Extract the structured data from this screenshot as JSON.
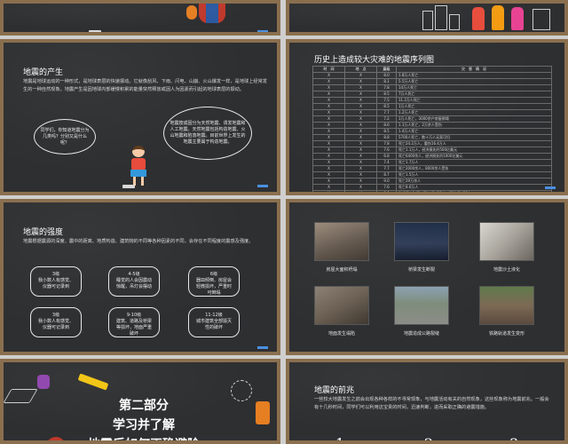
{
  "s3": {
    "title": "地震的产生",
    "para": "地震是地球运动的一种形式，是地球表层的快速振动。它就像刮风、下雨、闪电、山崩、火山爆发一样，是地球上经常发生的一种自然现象。地震产生是因地球内部缓慢积累的能量突然释放或因人为因素而引起的地球表层的振动。",
    "left_bubble": "同学们，你知道地震分为几类吗？分别又是什么呢？",
    "right_bubble": "地震按成因分为天然地震、诱发地震和人工地震。天然地震包括构造地震、火山地震和陷落地震。目前世界上发生的地震主要属于构造地震。"
  },
  "s4": {
    "title": "历史上造成较大灾难的地震序列图",
    "headers": [
      "时　间",
      "地　点",
      "震级",
      "灾　害　情　况"
    ],
    "rows": [
      [
        "X",
        "X",
        "8.0",
        "1.8万人死亡"
      ],
      [
        "X",
        "X",
        "8.1",
        "5.5万人死亡"
      ],
      [
        "X",
        "X",
        "7.8",
        "14万人死亡"
      ],
      [
        "X",
        "X",
        "8.5",
        "7万人死亡"
      ],
      [
        "X",
        "X",
        "7.5",
        "11.2万人死亡"
      ],
      [
        "X",
        "X",
        "8.5",
        "1万人死亡"
      ],
      [
        "X",
        "X",
        "7.7",
        "1.2万人死亡"
      ],
      [
        "X",
        "X",
        "7.2",
        "1万人死亡，3000余户房屋倒塌"
      ],
      [
        "X",
        "X",
        "8.6",
        "1.1万人死亡，2万余人受伤"
      ],
      [
        "X",
        "X",
        "8.5",
        "1.4万人死亡"
      ],
      [
        "X",
        "X",
        "8.8",
        "5700人死亡，数十万人无家可归"
      ],
      [
        "X",
        "X",
        "7.8",
        "死亡24.2万人，重伤16.4万人"
      ],
      [
        "X",
        "X",
        "7.6",
        "死亡1.1万人，经济损失约500亿美元"
      ],
      [
        "X",
        "X",
        "6.8",
        "死亡6400余人，经济损失约1000亿美元"
      ],
      [
        "X",
        "X",
        "7.4",
        "死亡1.7万人"
      ],
      [
        "X",
        "X",
        "7.7",
        "死亡2000余人，8000余人受伤"
      ],
      [
        "X",
        "X",
        "8.7",
        "死亡1.5万人"
      ],
      [
        "X",
        "X",
        "9.0",
        "死亡29万余人"
      ],
      [
        "X",
        "X",
        "7.6",
        "死亡8.6万人"
      ],
      [
        "X",
        "X",
        "8.0",
        "引起巨大海啸，死亡超过10人，损失超过10亿"
      ],
      [
        "X",
        "X",
        "",
        "死亡人数超过10人"
      ],
      [
        "X",
        "X",
        "8.0",
        "死亡6.9万人"
      ],
      [
        "X",
        "X",
        "7.1",
        "遇难人数2698人，经济损失超过1万亿人民币"
      ]
    ],
    "note": "在中国科学院，2008年5月12日的汶川地震是新中国成立以来破坏力最大的地震，也是唐山大地震后伤亡最严重的一次地震。"
  },
  "s5": {
    "title": "地震的强度",
    "para": "地震根据震源的深度、震中的距离、地质构造、建筑物的不同等各种因素的不同，会存在不同程度的震感及强度。",
    "levels": [
      {
        "lv": "3级",
        "desc": "我小数人有感觉、仪器可记录到"
      },
      {
        "lv": "4-5级",
        "desc": "睡觉的人会因震动惊醒，吊灯会摆动"
      },
      {
        "lv": "6级",
        "desc": "器皿倾倒、房屋会轻微损坏，严重时可倒塌"
      },
      {
        "lv": "3级",
        "desc": "我小数人有感觉、仪器可记录到"
      },
      {
        "lv": "9-10级",
        "desc": "建筑、道路及桥梁等损坏，地面严重破坏"
      },
      {
        "lv": "11-12级",
        "desc": "城市建筑全部毁灭性的破坏"
      }
    ]
  },
  "s6": {
    "captions": [
      "房屋大面积坍塌",
      "桥梁发生断裂",
      "地震沙土液化",
      "地面发生塌陷",
      "地震造成公路裂缝",
      "铁路轨道发生变形"
    ]
  },
  "s7": {
    "line1": "第二部分",
    "line2": "学习并了解",
    "line3": "地震后如何正确避险"
  },
  "s8": {
    "title": "地震的前兆",
    "para": "一些较大地震发生之前会出现各种各样的不寻常现象，与地震活动有关的自然现象，这些现象称为地震前兆。一般会有十几秒时间，同学们可以利用这宝贵的时间，迅速判断，进而采取正确的避震措施。",
    "numbers": [
      "1",
      "2",
      "3"
    ]
  }
}
